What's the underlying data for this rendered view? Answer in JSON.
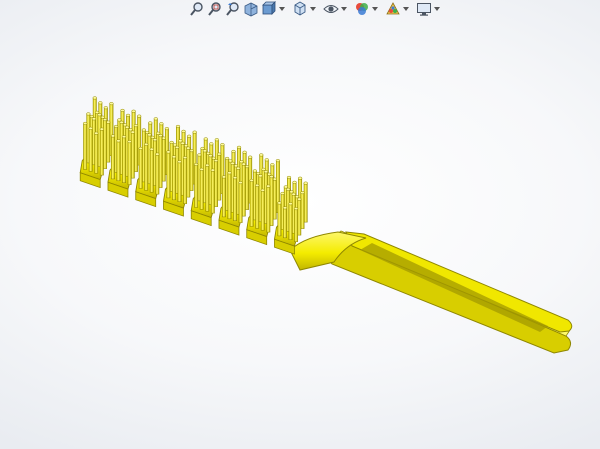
{
  "viewport": {
    "background": "#f6f7f9"
  },
  "toolbar": {
    "buttons": [
      {
        "icon": "zoom-to-fit-icon"
      },
      {
        "icon": "zoom-to-area-icon"
      },
      {
        "icon": "previous-view-icon"
      },
      {
        "icon": "section-view-icon"
      },
      {
        "icon": "view-orientation-icon",
        "dropdown": true
      },
      {
        "icon": "display-style-icon",
        "dropdown": true
      },
      {
        "icon": "hide-show-items-icon",
        "dropdown": true
      },
      {
        "icon": "edit-appearance-icon",
        "dropdown": true
      },
      {
        "icon": "apply-scene-icon",
        "dropdown": true
      },
      {
        "icon": "view-settings-icon",
        "dropdown": true
      }
    ]
  },
  "model": {
    "part": "hairbrush",
    "color": "#f4ec00",
    "shade_color": "#b9ad00",
    "highlight_color": "#fffb8a"
  }
}
